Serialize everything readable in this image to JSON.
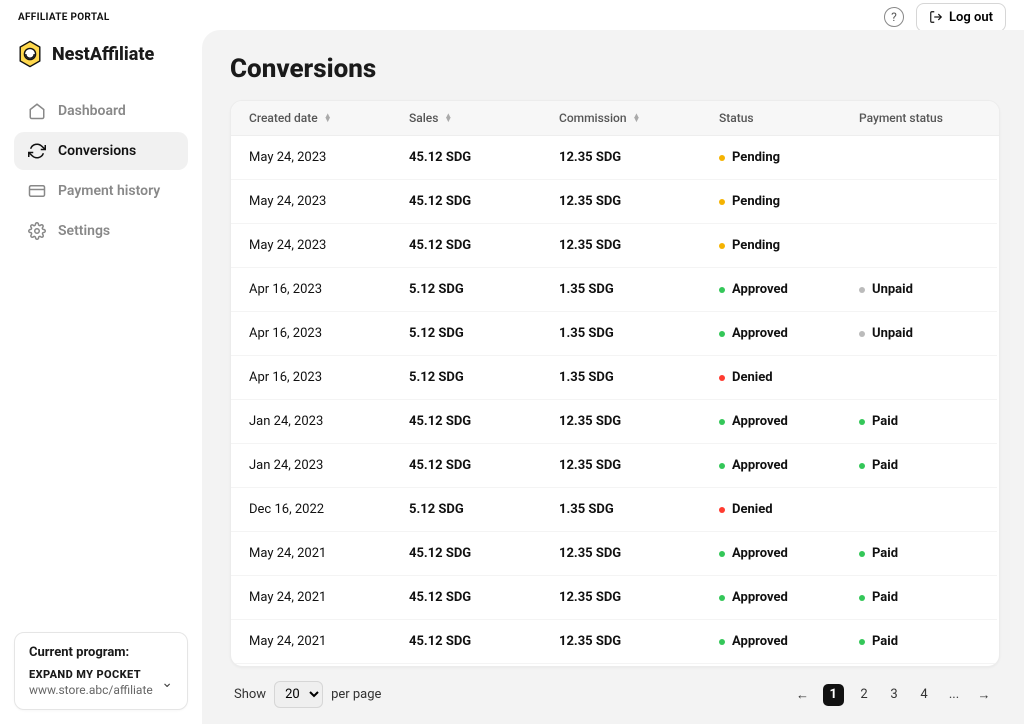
{
  "topbar": {
    "portal_label": "AFFILIATE PORTAL",
    "logout": "Log out"
  },
  "brand": {
    "name": "NestAffiliate"
  },
  "nav": [
    {
      "id": "dashboard",
      "label": "Dashboard"
    },
    {
      "id": "conversions",
      "label": "Conversions"
    },
    {
      "id": "payment-history",
      "label": "Payment history"
    },
    {
      "id": "settings",
      "label": "Settings"
    }
  ],
  "program": {
    "heading": "Current program:",
    "name": "EXPAND MY POCKET",
    "url": "www.store.abc/affiliate"
  },
  "page": {
    "title": "Conversions"
  },
  "table": {
    "headers": {
      "date": "Created date",
      "sales": "Sales",
      "commission": "Commission",
      "status": "Status",
      "payment": "Payment status"
    },
    "rows": [
      {
        "date": "May 24, 2023",
        "sales": "45.12 SDG",
        "commission": "12.35 SDG",
        "status": "Pending",
        "status_color": "#f5b301",
        "payment": "",
        "payment_color": ""
      },
      {
        "date": "May 24, 2023",
        "sales": "45.12 SDG",
        "commission": "12.35 SDG",
        "status": "Pending",
        "status_color": "#f5b301",
        "payment": "",
        "payment_color": ""
      },
      {
        "date": "May 24, 2023",
        "sales": "45.12 SDG",
        "commission": "12.35 SDG",
        "status": "Pending",
        "status_color": "#f5b301",
        "payment": "",
        "payment_color": ""
      },
      {
        "date": "Apr 16, 2023",
        "sales": "5.12 SDG",
        "commission": "1.35 SDG",
        "status": "Approved",
        "status_color": "#34c759",
        "payment": "Unpaid",
        "payment_color": "#bbbbbb"
      },
      {
        "date": "Apr 16, 2023",
        "sales": "5.12 SDG",
        "commission": "1.35 SDG",
        "status": "Approved",
        "status_color": "#34c759",
        "payment": "Unpaid",
        "payment_color": "#bbbbbb"
      },
      {
        "date": "Apr 16, 2023",
        "sales": "5.12 SDG",
        "commission": "1.35 SDG",
        "status": "Denied",
        "status_color": "#ff3b30",
        "payment": "",
        "payment_color": ""
      },
      {
        "date": "Jan 24, 2023",
        "sales": "45.12 SDG",
        "commission": "12.35 SDG",
        "status": "Approved",
        "status_color": "#34c759",
        "payment": "Paid",
        "payment_color": "#34c759"
      },
      {
        "date": "Jan 24, 2023",
        "sales": "45.12 SDG",
        "commission": "12.35 SDG",
        "status": "Approved",
        "status_color": "#34c759",
        "payment": "Paid",
        "payment_color": "#34c759"
      },
      {
        "date": "Dec 16, 2022",
        "sales": "5.12 SDG",
        "commission": "1.35 SDG",
        "status": "Denied",
        "status_color": "#ff3b30",
        "payment": "",
        "payment_color": ""
      },
      {
        "date": "May 24, 2021",
        "sales": "45.12 SDG",
        "commission": "12.35 SDG",
        "status": "Approved",
        "status_color": "#34c759",
        "payment": "Paid",
        "payment_color": "#34c759"
      },
      {
        "date": "May 24, 2021",
        "sales": "45.12 SDG",
        "commission": "12.35 SDG",
        "status": "Approved",
        "status_color": "#34c759",
        "payment": "Paid",
        "payment_color": "#34c759"
      },
      {
        "date": "May 24, 2021",
        "sales": "45.12 SDG",
        "commission": "12.35 SDG",
        "status": "Approved",
        "status_color": "#34c759",
        "payment": "Paid",
        "payment_color": "#34c759"
      }
    ]
  },
  "pager": {
    "show": "Show",
    "per_page": "per page",
    "selected": "20",
    "pages": [
      "1",
      "2",
      "3",
      "4",
      "..."
    ]
  }
}
